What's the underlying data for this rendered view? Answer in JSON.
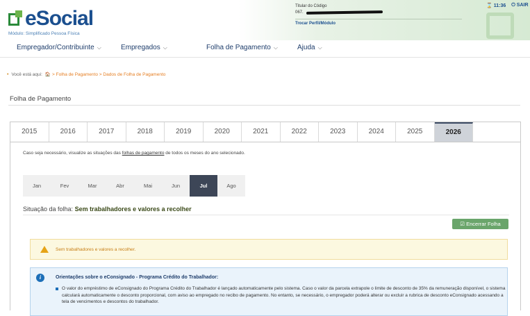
{
  "header": {
    "logo_text": "eSocial",
    "logo_subtitle": "Módulo: Simplificado Pessoa Física",
    "titular_label": "Titular do Código",
    "titular_code_prefix": "067.",
    "change_profile": "Trocar Perfil/Módulo",
    "timer": "11:36",
    "logout": "SAIR"
  },
  "nav": {
    "items": [
      {
        "label": "Empregador/Contribuinte"
      },
      {
        "label": "Empregados"
      },
      {
        "label": "Folha de Pagamento"
      },
      {
        "label": "Ajuda"
      }
    ]
  },
  "breadcrumb": {
    "prefix": "Você está aqui:",
    "items": [
      "Folha de Pagamento",
      "Dados de Folha de Pagamento"
    ],
    "separator": ">"
  },
  "page": {
    "title": "Folha de Pagamento"
  },
  "years": {
    "items": [
      "2015",
      "2016",
      "2017",
      "2018",
      "2019",
      "2020",
      "2021",
      "2022",
      "2023",
      "2024",
      "2025",
      "2026"
    ],
    "selected": "2026"
  },
  "info": {
    "before": "Caso seja necessário, visualize as situações das ",
    "link": "folhas de pagamento",
    "after": " de todos os meses do ano selecionado."
  },
  "months": {
    "items": [
      "Jan",
      "Fev",
      "Mar",
      "Abr",
      "Mai",
      "Jun",
      "Jul",
      "Ago"
    ],
    "selected": "Jul"
  },
  "status": {
    "label": "Situação da folha: ",
    "value": "Sem trabalhadores e valores a recolher"
  },
  "actions": {
    "close_payroll": "Encerrar Folha"
  },
  "alert": {
    "text": "Sem trabalhadores e valores a recolher."
  },
  "orientation": {
    "title": "Orientações sobre o eConsignado - Programa Crédito do Trabalhador:",
    "text": "O valor do empréstimo de eConsignado do Programa Crédito do Trabalhador é lançado automaticamente pelo sistema. Caso o valor da parcela extrapole o limite de desconto de 35% da remuneração disponível, o sistema calculará automaticamente o desconto proporcional, com aviso ao empregado no recibo de pagamento. No entanto, se necessário, o empregador poderá alterar ou excluir a rubrica de desconto eConsignado acessando a tela de vencimentos e descontos do trabalhador."
  },
  "colors": {
    "brand_blue": "#1b4f8f",
    "brand_green": "#2a8a3a",
    "active_tab": "#3d4657",
    "button_green": "#6aa56b",
    "alert_text": "#c77d14"
  }
}
